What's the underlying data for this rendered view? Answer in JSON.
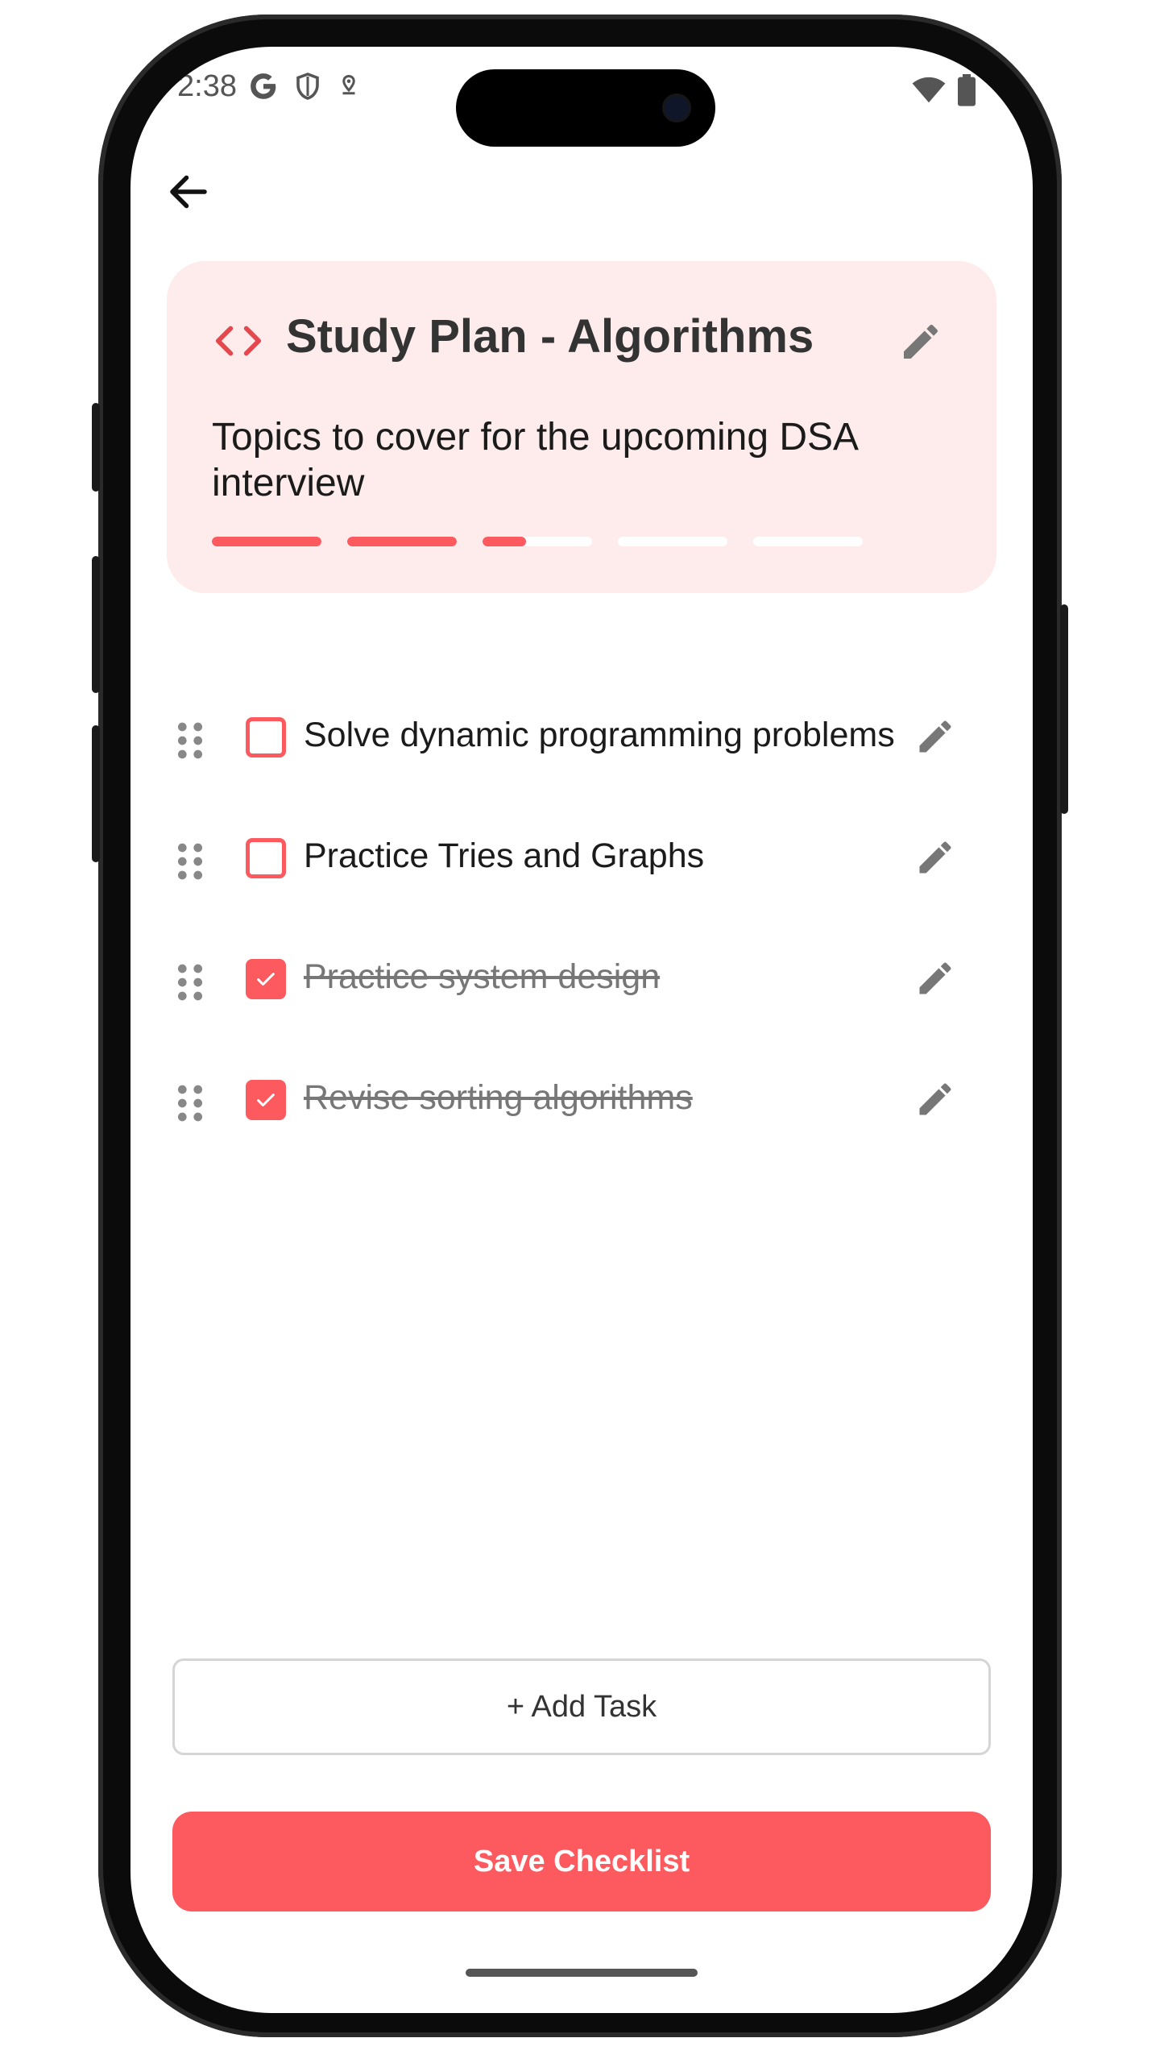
{
  "status_bar": {
    "time": "2:38",
    "left_icons": [
      "google-icon",
      "shield-icon",
      "location-icon"
    ],
    "right_icons": [
      "wifi-icon",
      "battery-icon"
    ]
  },
  "nav": {
    "back_icon": "arrow-left-icon"
  },
  "checklist": {
    "icon": "code-icon",
    "title": "Study Plan - Algorithms",
    "description": "Topics to cover for the upcoming DSA interview",
    "progress_segments": [
      1,
      1,
      0.4,
      0,
      0
    ],
    "accent_color": "#fc5a5f",
    "card_color": "#fdeceb"
  },
  "tasks": [
    {
      "label": "Solve dynamic programming problems",
      "done": false
    },
    {
      "label": "Practice Tries and Graphs",
      "done": false
    },
    {
      "label": "Practice system design",
      "done": true
    },
    {
      "label": "Revise sorting algorithms",
      "done": true
    }
  ],
  "actions": {
    "add_task_label": "+ Add Task",
    "save_label": "Save Checklist"
  }
}
